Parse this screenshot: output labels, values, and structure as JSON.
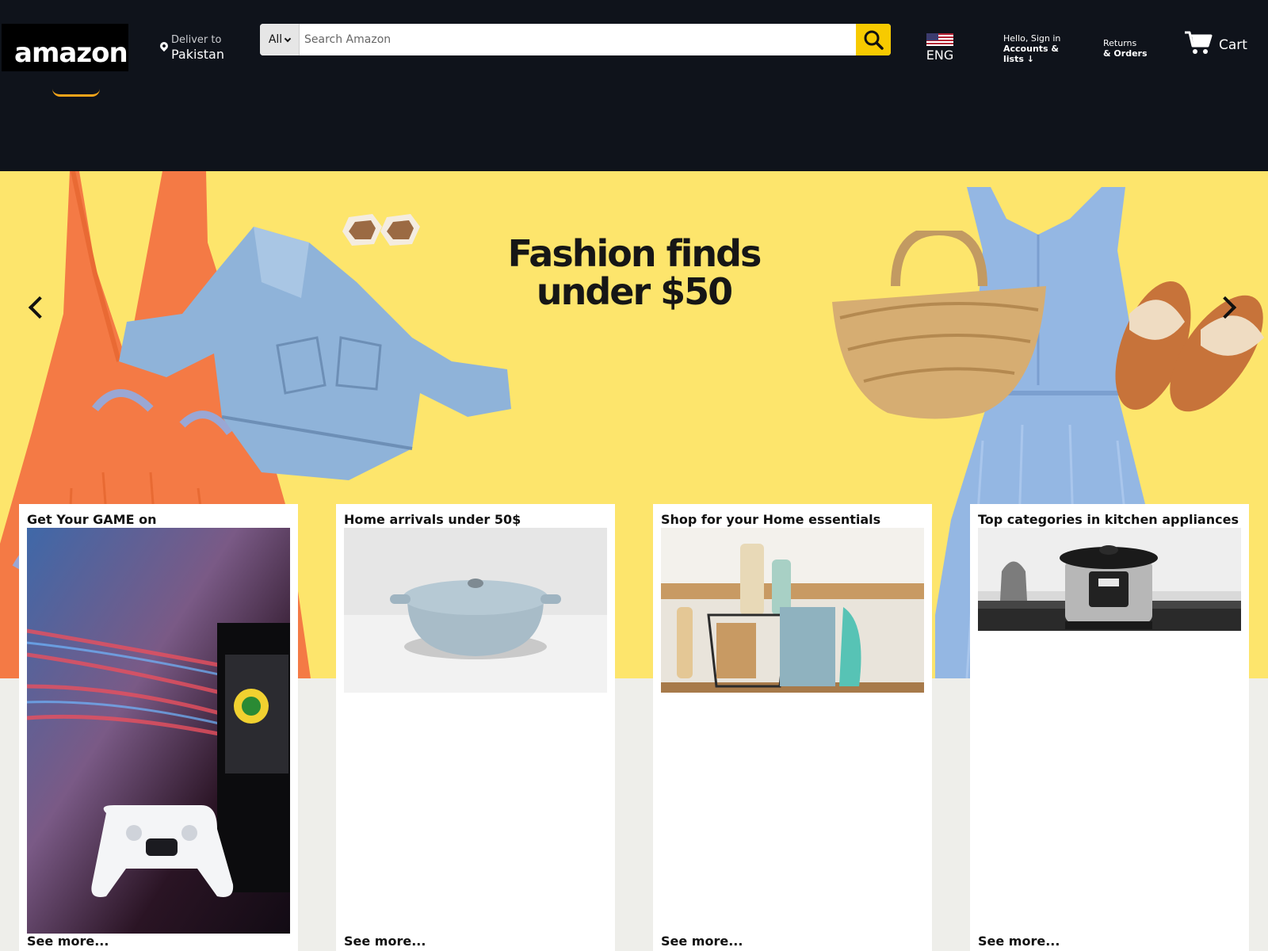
{
  "header": {
    "logo_text": "amazon",
    "deliver": {
      "label": "Deliver to",
      "location": "Pakistan"
    },
    "search": {
      "category": "All",
      "placeholder": "Search Amazon"
    },
    "language": "ENG",
    "account": {
      "greeting": "Hello, Sign in",
      "label": "Accounts & lists",
      "arrow": "↓"
    },
    "returns": {
      "line1": "Returns",
      "line2": "& Orders"
    },
    "cart": {
      "label": "Cart"
    }
  },
  "hero": {
    "title_line1": "Fashion finds",
    "title_line2": "under $50"
  },
  "cards": [
    {
      "title": "Get Your GAME on",
      "see_more": "See more..."
    },
    {
      "title": "Home arrivals under 50$",
      "see_more": "See more..."
    },
    {
      "title": "Shop for your Home essentials",
      "see_more": "See more..."
    },
    {
      "title": "Top categories in kitchen appliances",
      "see_more": "See more..."
    }
  ],
  "colors": {
    "header_bg": "#0f131b",
    "search_button": "#f7ca00",
    "hero_bg": "#fde56c",
    "page_bg": "#eeeeea"
  }
}
